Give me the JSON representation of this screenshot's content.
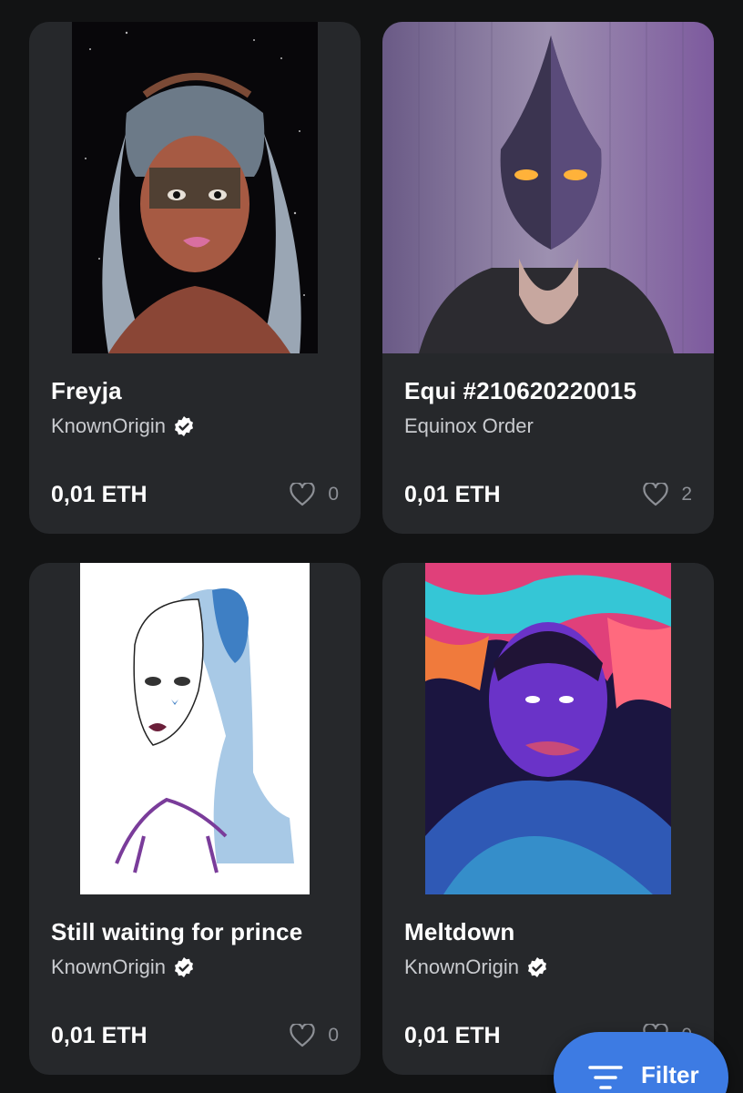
{
  "cards": [
    {
      "title": "Freyja",
      "creator": "KnownOrigin",
      "verified": true,
      "price": "0,01 ETH",
      "likes": "0"
    },
    {
      "title": "Equi #210620220015",
      "creator": "Equinox Order",
      "verified": false,
      "price": "0,01 ETH",
      "likes": "2"
    },
    {
      "title": "Still waiting for prince",
      "creator": "KnownOrigin",
      "verified": true,
      "price": "0,01 ETH",
      "likes": "0"
    },
    {
      "title": "Meltdown",
      "creator": "KnownOrigin",
      "verified": true,
      "price": "0,01 ETH",
      "likes": "0"
    }
  ],
  "filter": {
    "label": "Filter",
    "icon": "filter-lines-icon"
  },
  "colors": {
    "background": "#121314",
    "card": "#26282b",
    "accent": "#3d7be3",
    "verified_badge": "#ffffff"
  }
}
